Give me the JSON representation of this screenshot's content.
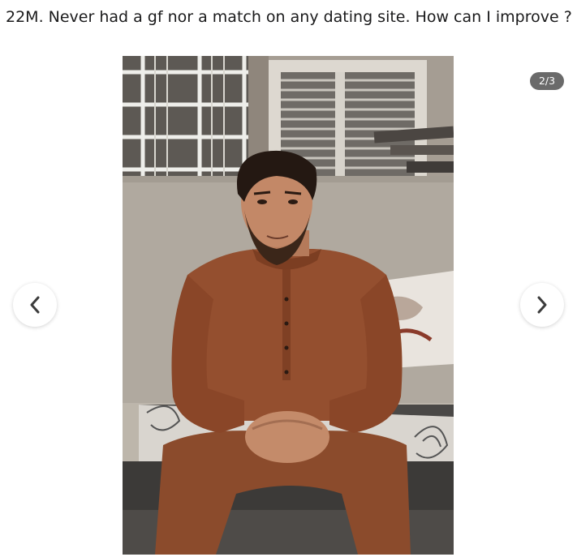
{
  "post": {
    "title": "22M. Never had a gf nor a match on any dating site. How can I improve ?"
  },
  "gallery": {
    "counter": "2/3",
    "image_alt": "Young man with beard in a brown kurta sitting on a bench outdoors",
    "prev_icon": "chevron-left-icon",
    "next_icon": "chevron-right-icon"
  },
  "colors": {
    "counter_bg": "#505050",
    "nav_button_bg": "#ffffff",
    "title_text": "#1a1a1b"
  }
}
